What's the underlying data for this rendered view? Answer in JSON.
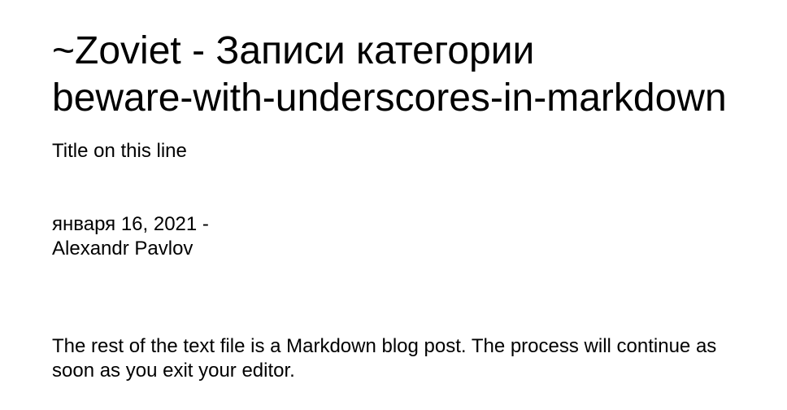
{
  "page": {
    "title_line1": "~Zoviet - Записи категории",
    "title_line2": "beware-with-underscores-in-markdown",
    "subtitle": "Title on this line"
  },
  "post": {
    "date_line": "января 16, 2021 -",
    "author": "Alexandr Pavlov",
    "body": "The rest of the text file is a Markdown blog post. The process will continue as soon as you exit your editor."
  }
}
